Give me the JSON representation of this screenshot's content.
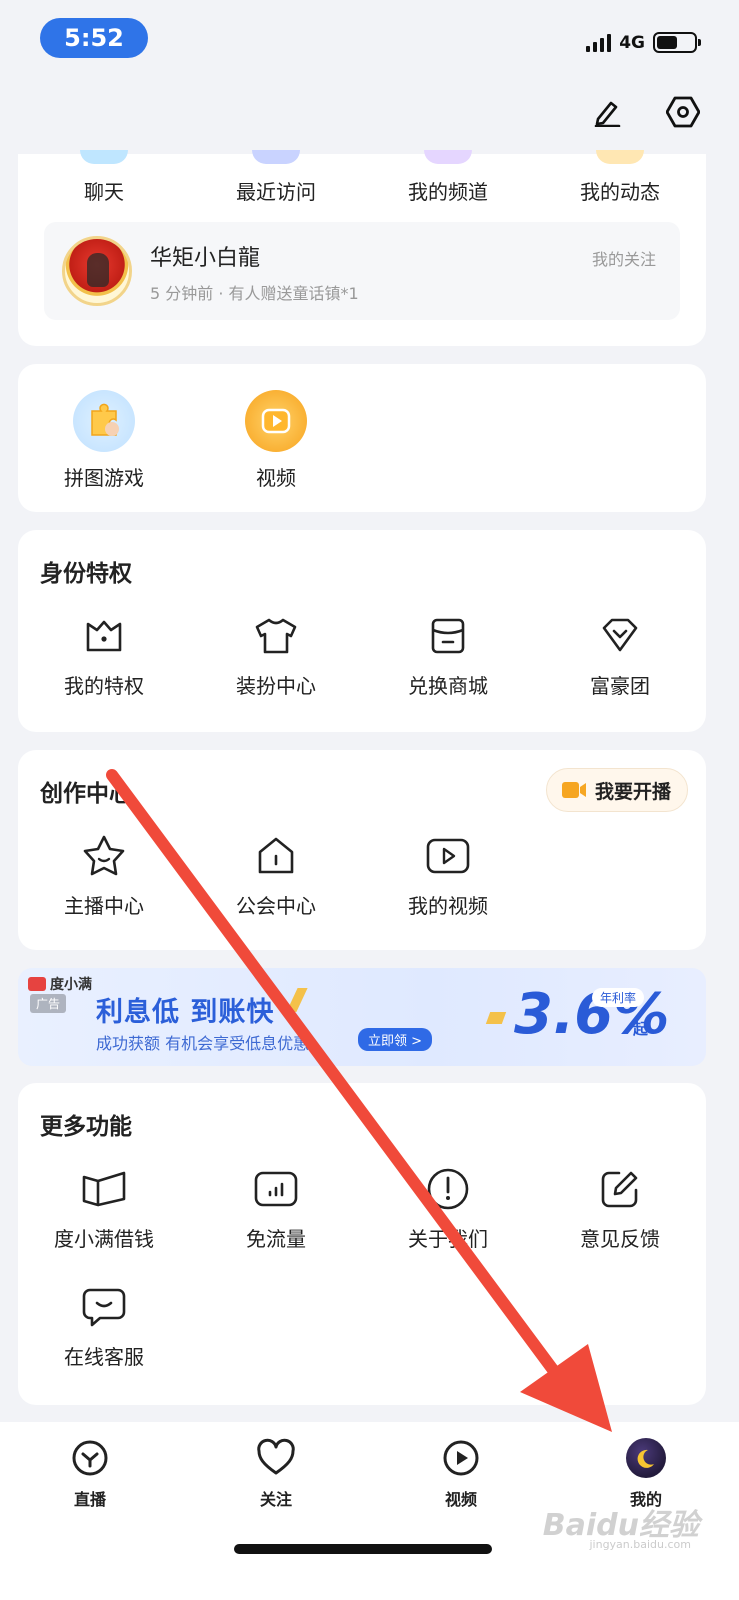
{
  "status_bar": {
    "time": "5:52",
    "network": "4G",
    "battery_level": 0.55
  },
  "top_actions": {
    "edit_icon": "pencil-icon",
    "settings_icon": "hexagon-settings-icon"
  },
  "quick_row": {
    "items": [
      {
        "label": "聊天",
        "color": "#bfe6ff"
      },
      {
        "label": "最近访问",
        "color": "#c9d3ff"
      },
      {
        "label": "我的频道",
        "color": "#e5d6ff"
      },
      {
        "label": "我的动态",
        "color": "#ffe7b3"
      }
    ]
  },
  "follow_card": {
    "name": "华矩小白龍",
    "subtitle": "5 分钟前 · 有人赠送童话镇*1",
    "tag": "我的关注"
  },
  "apps_card": {
    "items": [
      {
        "label": "拼图游戏",
        "icon": "puzzle-icon"
      },
      {
        "label": "视频",
        "icon": "video-play-icon"
      }
    ]
  },
  "identity_card": {
    "title": "身份特权",
    "items": [
      {
        "label": "我的特权",
        "icon": "crown-icon"
      },
      {
        "label": "装扮中心",
        "icon": "tshirt-icon"
      },
      {
        "label": "兑换商城",
        "icon": "store-icon"
      },
      {
        "label": "富豪团",
        "icon": "diamond-icon"
      }
    ]
  },
  "creation_card": {
    "title": "创作中心",
    "live_button": "我要开播",
    "items": [
      {
        "label": "主播中心",
        "icon": "star-face-icon"
      },
      {
        "label": "公会中心",
        "icon": "house-icon"
      },
      {
        "label": "我的视频",
        "icon": "play-box-icon"
      }
    ]
  },
  "ad_banner": {
    "brand": "度小满",
    "tag": "广告",
    "headline": "利息低 到账快",
    "subline": "成功获额 有机会享受低息优惠",
    "cta": "立即领 >",
    "rate_label": "年利率",
    "rate": "3.6%",
    "rate_suffix": "起"
  },
  "more_card": {
    "title": "更多功能",
    "items": [
      {
        "label": "度小满借钱",
        "icon": "book-open-icon"
      },
      {
        "label": "免流量",
        "icon": "signal-box-icon"
      },
      {
        "label": "关于我们",
        "icon": "info-exclaim-icon"
      },
      {
        "label": "意见反馈",
        "icon": "edit-square-icon"
      },
      {
        "label": "在线客服",
        "icon": "chat-smile-icon"
      }
    ]
  },
  "tab_bar": {
    "tabs": [
      {
        "label": "直播",
        "icon": "live-icon"
      },
      {
        "label": "关注",
        "icon": "heart-icon"
      },
      {
        "label": "视频",
        "icon": "play-circle-icon"
      },
      {
        "label": "我的",
        "icon": "avatar-icon"
      }
    ]
  },
  "watermark": {
    "text": "Baidu经验",
    "sub": "jingyan.baidu.com"
  },
  "colors": {
    "accent": "#2f74e8",
    "annotation_red": "#f04a3a",
    "background": "#f2f3f7"
  }
}
